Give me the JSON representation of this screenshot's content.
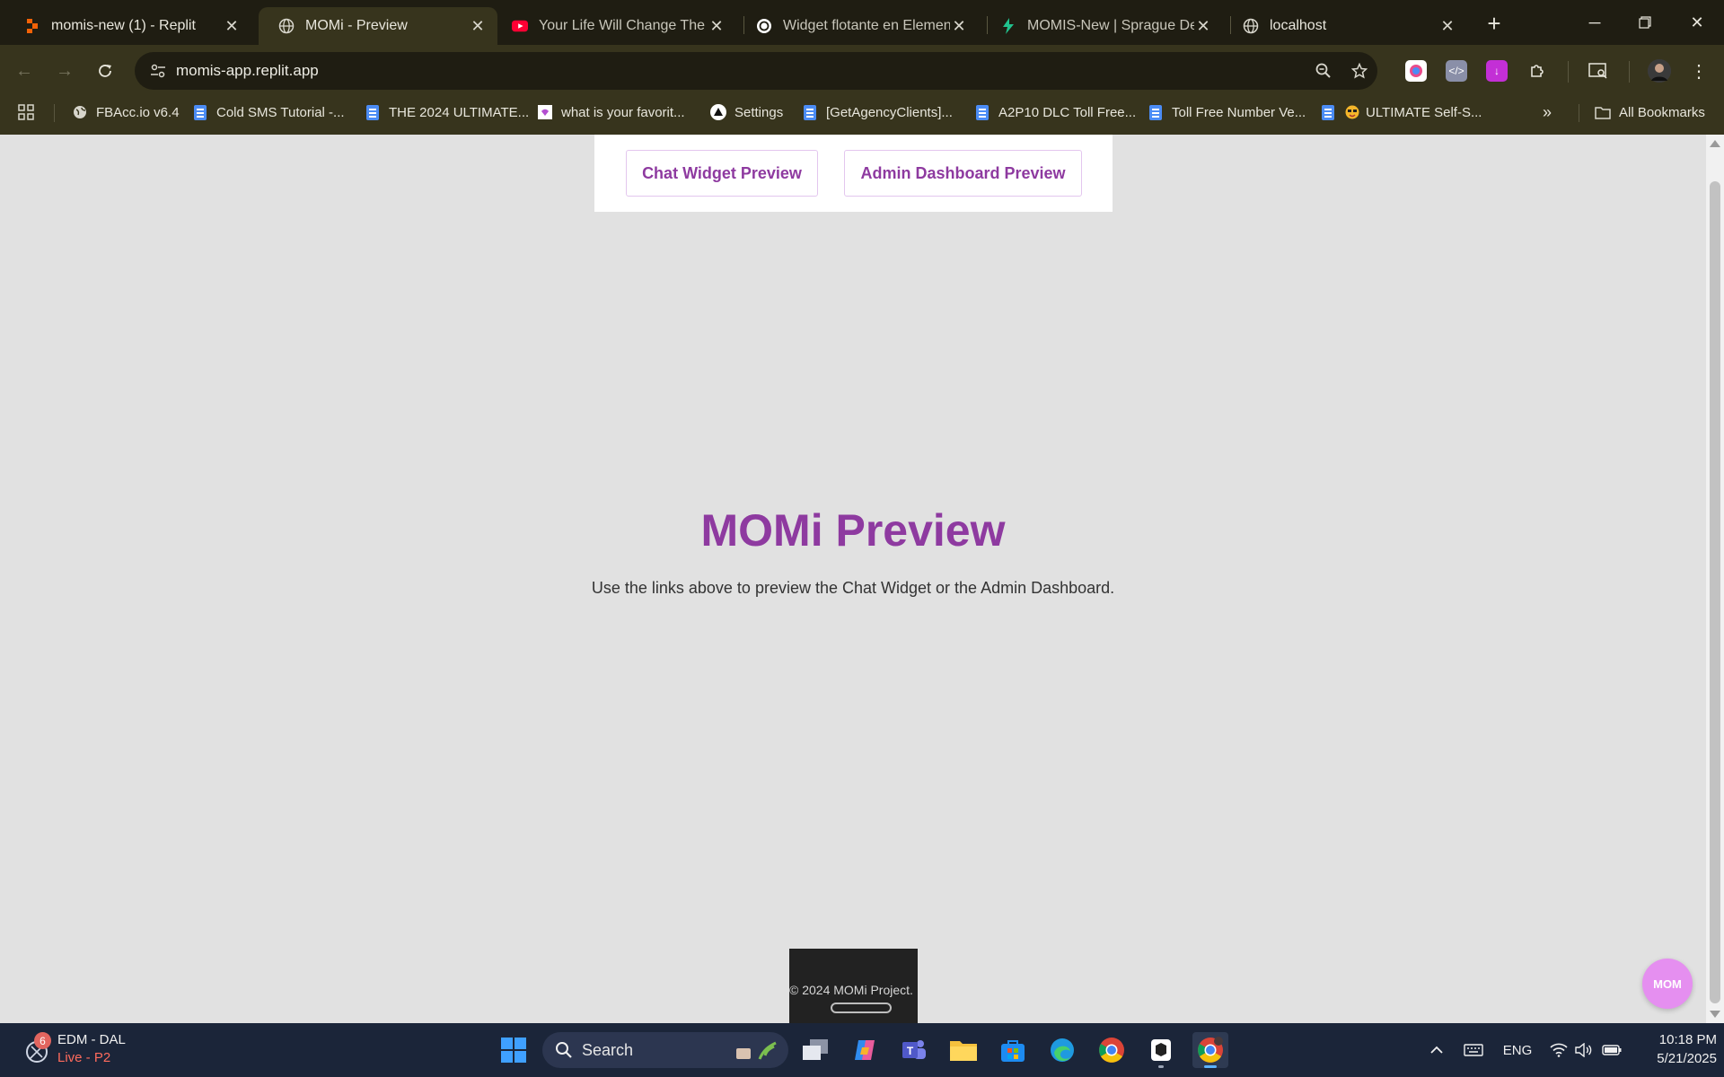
{
  "tabs": [
    {
      "title": "momis-new (1) - Replit",
      "icon": "replit-icon",
      "active": false
    },
    {
      "title": "MOMi - Preview",
      "icon": "globe-icon",
      "active": true
    },
    {
      "title": "Your Life Will Change The D",
      "icon": "youtube-icon",
      "active": false
    },
    {
      "title": "Widget flotante en Element",
      "icon": "chatgpt-icon",
      "active": false
    },
    {
      "title": "MOMIS-New | Sprague Des",
      "icon": "bolt-icon",
      "active": false
    },
    {
      "title": "localhost",
      "icon": "globe-icon",
      "active": false
    }
  ],
  "address_bar": {
    "url": "momis-app.replit.app"
  },
  "bookmarks": [
    {
      "label": "FBAcc.io v6.4",
      "icon": "globe-icon"
    },
    {
      "label": "Cold SMS Tutorial -...",
      "icon": "doc-icon"
    },
    {
      "label": "THE 2024 ULTIMATE...",
      "icon": "doc-icon"
    },
    {
      "label": "what is your favorit...",
      "icon": "notion-icon"
    },
    {
      "label": "Settings",
      "icon": "triangle-icon"
    },
    {
      "label": "[GetAgencyClients]...",
      "icon": "doc-icon"
    },
    {
      "label": "A2P10 DLC Toll Free...",
      "icon": "doc-icon"
    },
    {
      "label": "Toll Free Number Ve...",
      "icon": "doc-icon"
    },
    {
      "label": "ULTIMATE Self-S...",
      "icon": "doc-emoji-icon"
    }
  ],
  "all_bookmarks_label": "All Bookmarks",
  "page": {
    "nav": {
      "chat_widget_label": "Chat Widget Preview",
      "admin_dashboard_label": "Admin Dashboard Preview"
    },
    "title": "MOMi Preview",
    "subtitle": "Use the links above to preview the Chat Widget or the Admin Dashboard.",
    "footer_text": "© 2024 MOMi Project.",
    "chat_bubble_label": "MOM"
  },
  "taskbar": {
    "weather_badge": "6",
    "weather_title": "EDM - DAL",
    "weather_sub": "Live - P2",
    "search_label": "Search",
    "language": "ENG",
    "time": "10:18 PM",
    "date": "5/21/2025"
  },
  "colors": {
    "accent": "#8e3aa0",
    "page_bg": "#e1e1e1",
    "browser_chrome": "#37341d",
    "taskbar": "#1b2539"
  }
}
